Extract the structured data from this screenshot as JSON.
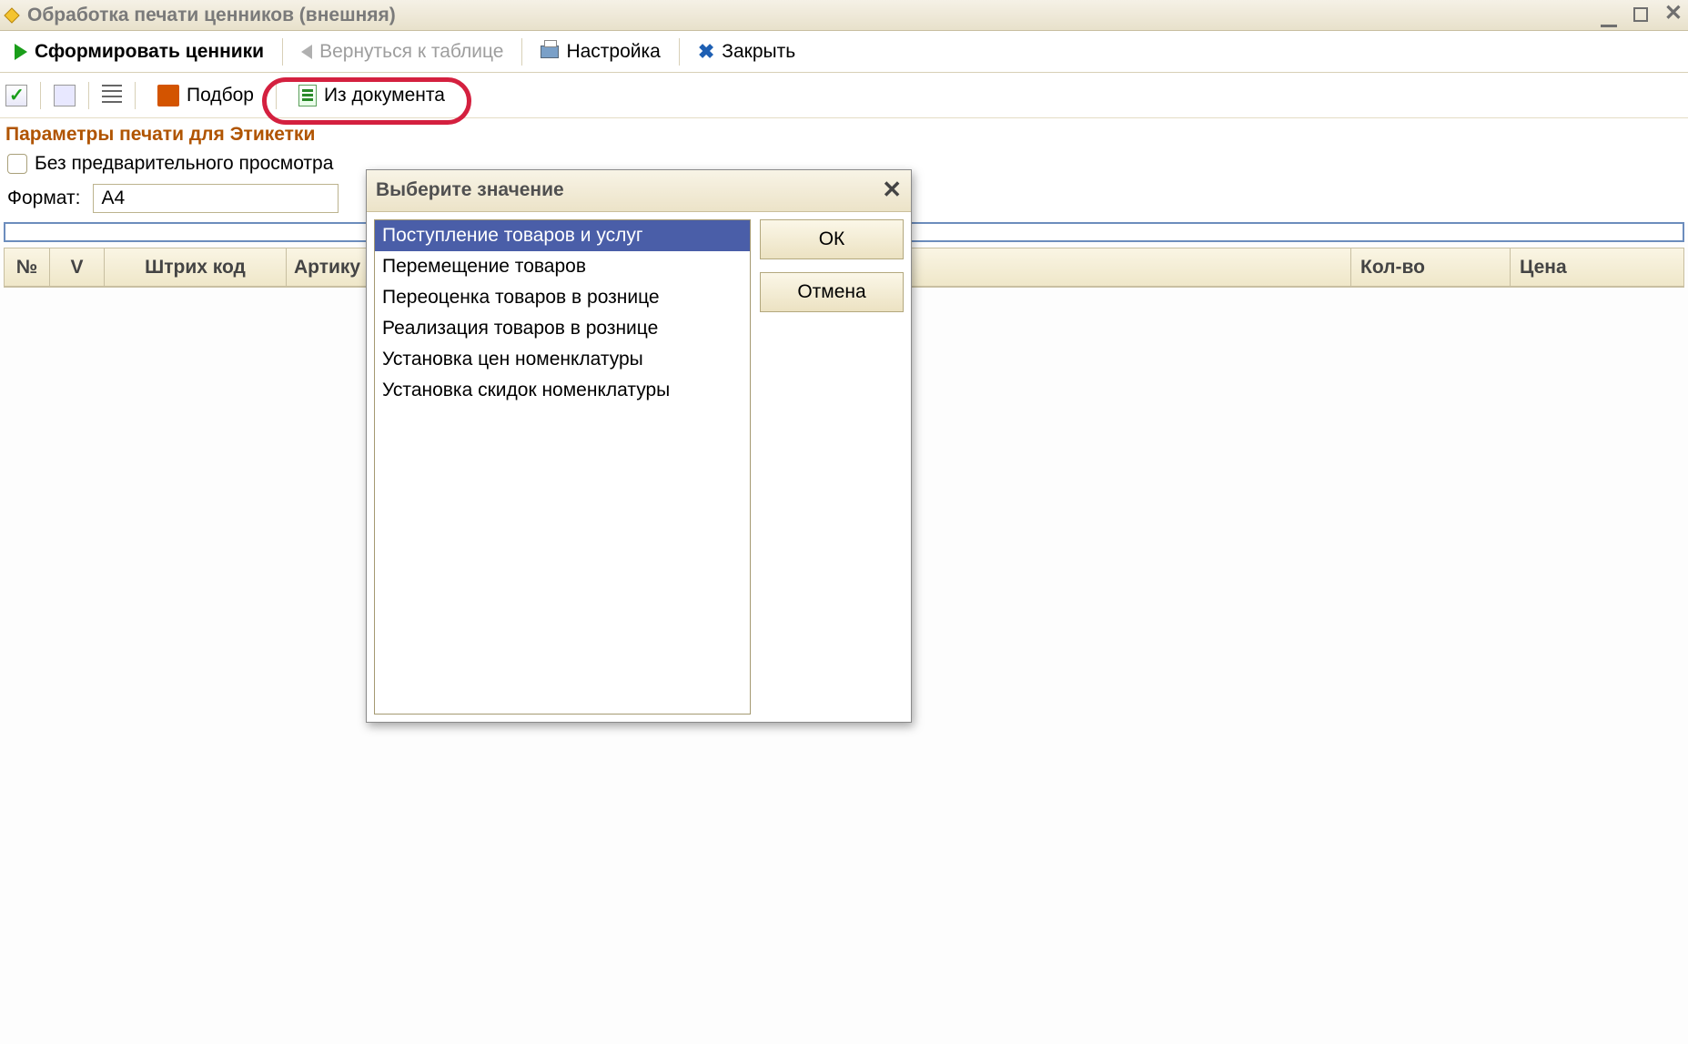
{
  "window": {
    "title": "Обработка печати ценников (внешняя)"
  },
  "toolbar1": {
    "generate": "Сформировать ценники",
    "back_to_table": "Вернуться к таблице",
    "settings": "Настройка",
    "close": "Закрыть"
  },
  "toolbar2": {
    "pick": "Подбор",
    "from_document": "Из документа"
  },
  "section_heading": "Параметры печати для Этикетки",
  "params": {
    "no_preview_label": "Без предварительного просмотра",
    "format_label": "Формат:",
    "format_value": "А4"
  },
  "grid": {
    "columns": {
      "num": "№",
      "v": "V",
      "barcode": "Штрих код",
      "article": "Артику",
      "qty": "Кол-во",
      "price": "Цена"
    }
  },
  "modal": {
    "title": "Выберите значение",
    "ok": "ОК",
    "cancel": "Отмена",
    "items": [
      "Поступление товаров и услуг",
      "Перемещение товаров",
      "Переоценка товаров в рознице",
      "Реализация товаров в рознице",
      "Установка цен номенклатуры",
      "Установка скидок номенклатуры"
    ],
    "selected_index": 0
  }
}
